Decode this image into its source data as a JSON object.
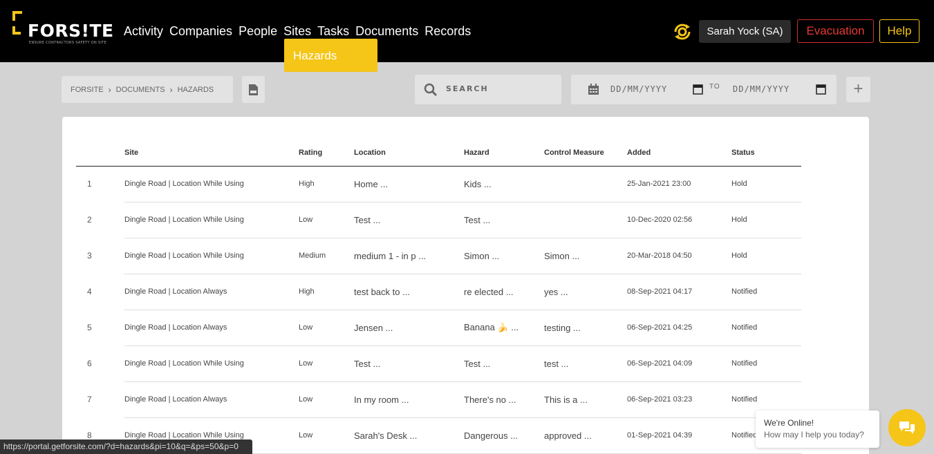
{
  "brand": {
    "name": "FORS!TE",
    "tagline": "ENSURE CONTRACTORS SAFETY ON SITE",
    "accent": "#f5c518"
  },
  "nav": {
    "items": [
      "Activity",
      "Companies",
      "People",
      "Sites",
      "Tasks",
      "Documents",
      "Records"
    ],
    "dropdown_item": "Hazards"
  },
  "header": {
    "user": "Sarah Yock (SA)",
    "evacuation": "Evacuation",
    "help": "Help",
    "sync_icon": "sync-gear-icon"
  },
  "breadcrumb": [
    "FORSITE",
    "DOCUMENTS",
    "HAZARDS"
  ],
  "toolbar": {
    "export_icon": "csv-file-icon",
    "search_placeholder": "SEARCH",
    "date_from_placeholder": "DD/MM/YYYY",
    "date_to_label": "TO",
    "date_to_placeholder": "DD/MM/YYYY",
    "add_label": "+"
  },
  "table": {
    "columns": [
      "",
      "Site",
      "Rating",
      "Location",
      "Hazard",
      "Control Measure",
      "Added",
      "Status"
    ],
    "rows": [
      {
        "n": "1",
        "site": "Dingle Road | Location While Using",
        "rating": "High",
        "location": "Home ...",
        "hazard": "Kids ...",
        "control": "",
        "added": "25-Jan-2021 23:00",
        "status": "Hold"
      },
      {
        "n": "2",
        "site": "Dingle Road | Location While Using",
        "rating": "Low",
        "location": "Test ...",
        "hazard": "Test ...",
        "control": "",
        "added": "10-Dec-2020 02:56",
        "status": "Hold"
      },
      {
        "n": "3",
        "site": "Dingle Road | Location While Using",
        "rating": "Medium",
        "location": "medium 1 - in p ...",
        "hazard": "Simon ...",
        "control": "Simon ...",
        "added": "20-Mar-2018 04:50",
        "status": "Hold"
      },
      {
        "n": "4",
        "site": "Dingle Road | Location Always",
        "rating": "High",
        "location": "test back to ...",
        "hazard": "re elected ...",
        "control": "yes ...",
        "added": "08-Sep-2021 04:17",
        "status": "Notified"
      },
      {
        "n": "5",
        "site": "Dingle Road | Location Always",
        "rating": "Low",
        "location": "Jensen ...",
        "hazard": "Banana 🍌 ...",
        "control": "testing ...",
        "added": "06-Sep-2021 04:25",
        "status": "Notified"
      },
      {
        "n": "6",
        "site": "Dingle Road | Location While Using",
        "rating": "Low",
        "location": "Test ...",
        "hazard": "Test ...",
        "control": "test ...",
        "added": "06-Sep-2021 04:09",
        "status": "Notified"
      },
      {
        "n": "7",
        "site": "Dingle Road | Location Always",
        "rating": "Low",
        "location": "In my room ...",
        "hazard": "There's no ...",
        "control": "This is a ...",
        "added": "06-Sep-2021 03:23",
        "status": "Notified"
      },
      {
        "n": "8",
        "site": "Dingle Road | Location While Using",
        "rating": "Low",
        "location": "Sarah's Desk ...",
        "hazard": "Dangerous ...",
        "control": "approved ...",
        "added": "01-Sep-2021 04:39",
        "status": "Notified"
      }
    ]
  },
  "status_bar": {
    "url": "https://portal.getforsite.com/?d=hazards&pi=10&q=&ps=50&p=0"
  },
  "chat": {
    "title": "We're Online!",
    "subtitle": "How may I help you today?",
    "icon": "chat-icon"
  }
}
